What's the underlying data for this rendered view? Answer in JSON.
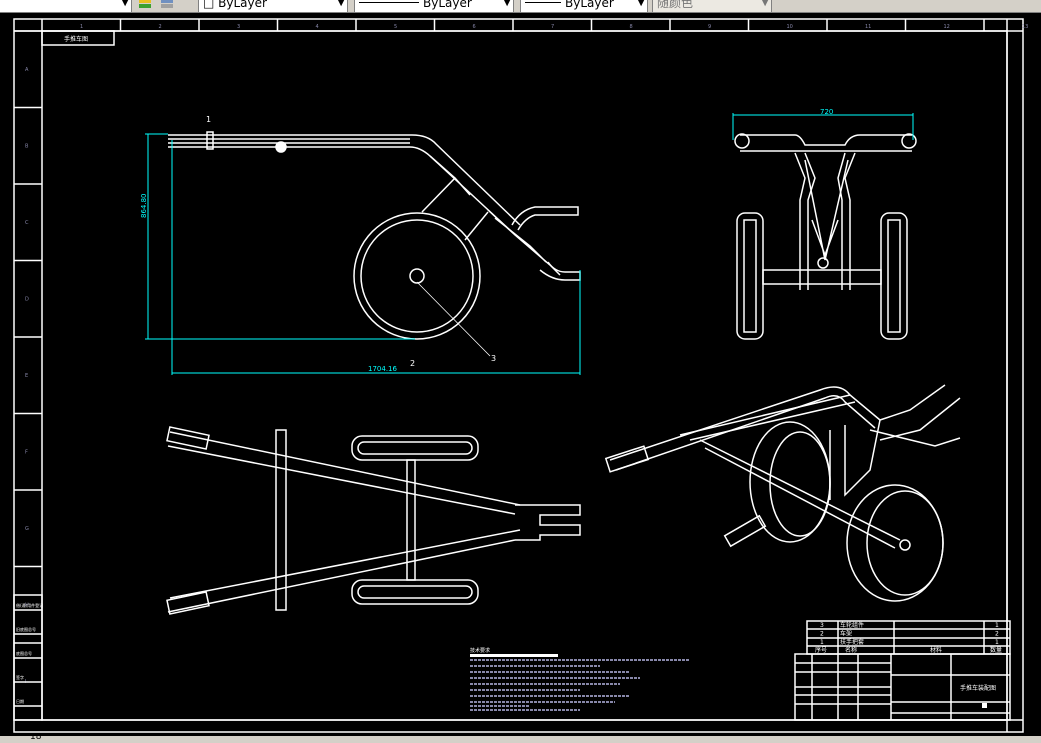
{
  "toolbar": {
    "layer_dropdown": {
      "value": "ByLayer"
    },
    "linetype_dropdown": {
      "value": "ByLayer"
    },
    "lineweight_dropdown": {
      "value": "ByLayer"
    },
    "plotstyle_dropdown": {
      "value": "随颜色"
    },
    "icons": [
      "layer-states-icon",
      "layer-previous-icon"
    ]
  },
  "drawing": {
    "background": "#000000",
    "line_color": "#ffffff",
    "dimension_color": "#00ffff",
    "ruler_top": [
      "1",
      "2",
      "3",
      "4",
      "5",
      "6",
      "7",
      "8",
      "9",
      "10",
      "11",
      "12",
      "13"
    ],
    "ruler_left": [
      "A",
      "B",
      "C",
      "D",
      "E",
      "F",
      "G",
      "H",
      "I"
    ],
    "drawing_no_box": "手推车图",
    "dimensions": {
      "height": "864.80",
      "length": "1704.16",
      "width": "720"
    },
    "balloons": [
      "1",
      "2",
      "3"
    ],
    "technical_notes_title": "技术要求",
    "parts_list": [
      {
        "no": "3",
        "name": "车轮组件",
        "qty": "1"
      },
      {
        "no": "2",
        "name": "车架",
        "qty": "2"
      },
      {
        "no": "1",
        "name": "扶手把套",
        "qty": "1"
      }
    ],
    "parts_header": {
      "no": "序号",
      "name": "名称",
      "material": "材料",
      "qty": "数量"
    },
    "title_block_name": "手推车装配图",
    "left_table": [
      "借(通)用件登记",
      "旧底图总号",
      "底图总号",
      "签字",
      "日期"
    ]
  },
  "status": {
    "coords": "18"
  }
}
